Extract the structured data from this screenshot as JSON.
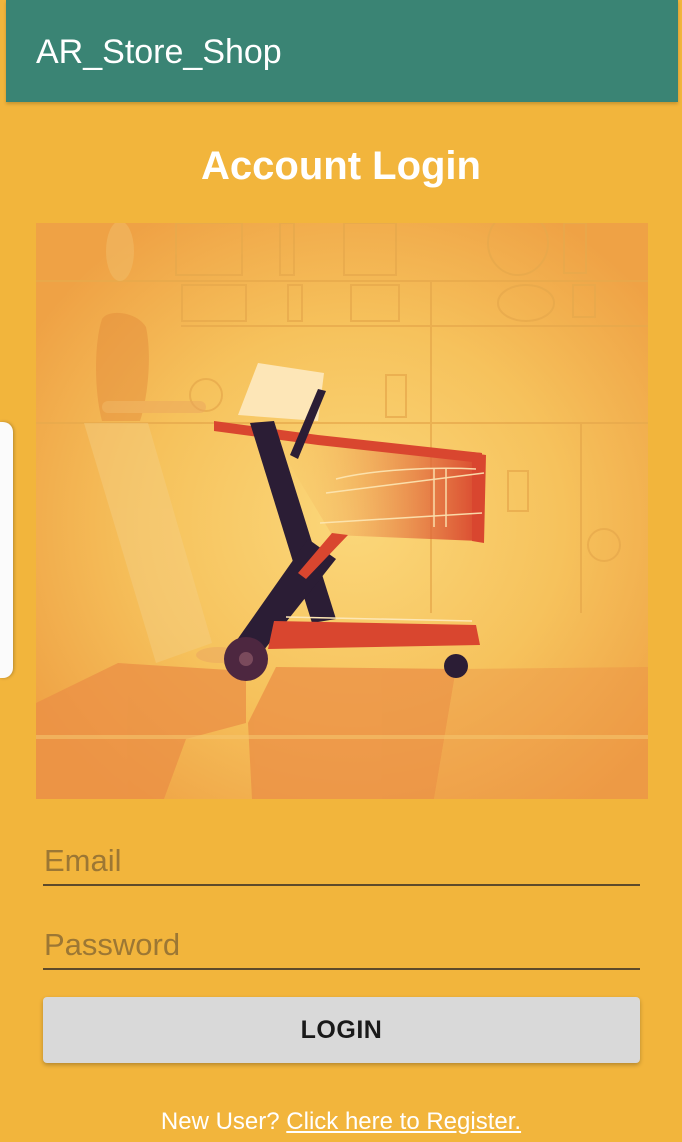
{
  "app_bar": {
    "title": "AR_Store_Shop"
  },
  "login": {
    "heading": "Account Login",
    "email_placeholder": "Email",
    "password_placeholder": "Password",
    "login_button": "LOGIN",
    "register_prompt": "New User?",
    "register_link": "Click here to Register."
  },
  "illustration": {
    "subject": "shopping cart illustration",
    "accent_colors": [
      "#f2b53c",
      "#d9462f",
      "#2b1d35"
    ]
  },
  "colors": {
    "app_bar": "#3a8474",
    "background": "#f2b53c",
    "button": "#d9d9d9"
  }
}
